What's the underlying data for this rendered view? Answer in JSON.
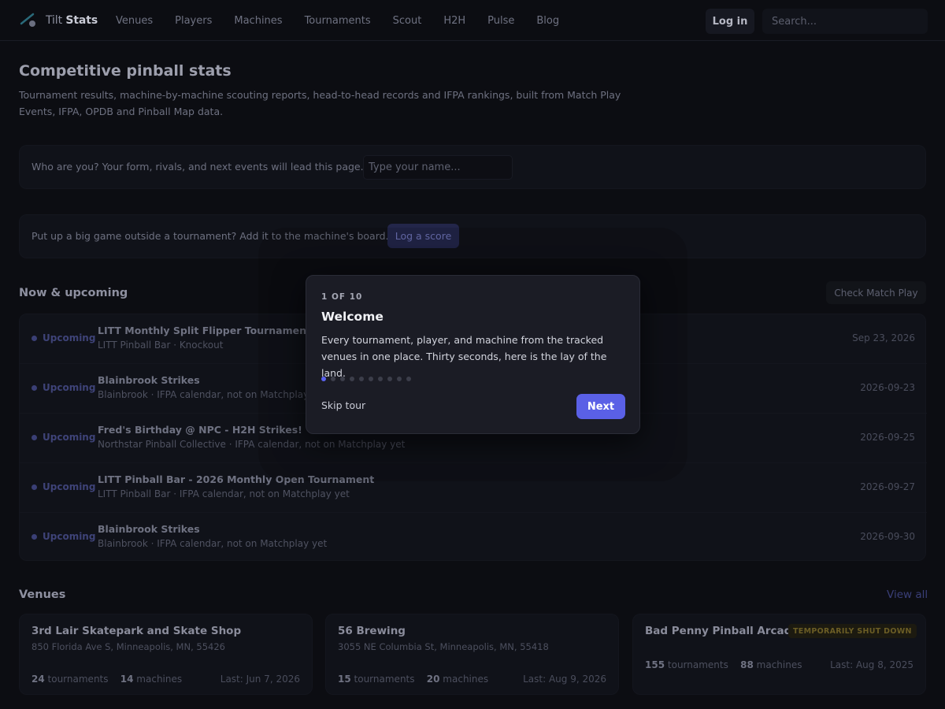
{
  "brand": {
    "prefix": "Tilt",
    "name": "Stats"
  },
  "nav": {
    "items": [
      "Venues",
      "Players",
      "Machines",
      "Tournaments",
      "Scout",
      "H2H",
      "Pulse",
      "Blog"
    ],
    "login_label": "Log in",
    "search_placeholder": "Search..."
  },
  "hero": {
    "title": "Competitive pinball stats",
    "subtitle": "Tournament results, machine-by-machine scouting reports, head-to-head records and IFPA rankings, built from Match Play Events, IFPA, OPDB and Pinball Map data."
  },
  "identify": {
    "prompt": "Who are you? Your form, rivals, and next events will lead this page.",
    "placeholder": "Type your name..."
  },
  "score": {
    "prompt": "Put up a big game outside a tournament? Add it to the machine's board.",
    "button_label": "Log a score"
  },
  "upcoming": {
    "title": "Now & upcoming",
    "check_label": "Check Match Play",
    "events": [
      {
        "status": "Upcoming",
        "title": "LITT Monthly Split Flipper Tournament - Se",
        "meta": "LITT Pinball Bar · Knockout",
        "date": "Sep 23, 2026"
      },
      {
        "status": "Upcoming",
        "title": "Blainbrook Strikes",
        "meta": "Blainbrook · IFPA calendar, not on Matchplay",
        "date": "2026-09-23"
      },
      {
        "status": "Upcoming",
        "title": "Fred's Birthday @ NPC - H2H Strikes!",
        "meta": "Northstar Pinball Collective · IFPA calendar, not on Matchplay yet",
        "date": "2026-09-25"
      },
      {
        "status": "Upcoming",
        "title": "LITT Pinball Bar - 2026 Monthly Open Tournament",
        "meta": "LITT Pinball Bar · IFPA calendar, not on Matchplay yet",
        "date": "2026-09-27"
      },
      {
        "status": "Upcoming",
        "title": "Blainbrook Strikes",
        "meta": "Blainbrook · IFPA calendar, not on Matchplay yet",
        "date": "2026-09-30"
      }
    ]
  },
  "venues": {
    "title": "Venues",
    "view_all_label": "View all",
    "tournaments_word": "tournaments",
    "machines_word": "machines",
    "items": [
      {
        "name": "3rd Lair Skatepark and Skate Shop",
        "address": "850 Florida Ave S, Minneapolis, MN, 55426",
        "tournaments": "24",
        "machines": "14",
        "last": "Last: Jun 7, 2026",
        "badge": ""
      },
      {
        "name": "56 Brewing",
        "address": "3055 NE Columbia St, Minneapolis, MN, 55418",
        "tournaments": "15",
        "machines": "20",
        "last": "Last: Aug 9, 2026",
        "badge": ""
      },
      {
        "name": "Bad Penny Pinball Arcade",
        "address": "",
        "tournaments": "155",
        "machines": "88",
        "last": "Last: Aug 8, 2025",
        "badge": "TEMPORARILY SHUT DOWN"
      }
    ]
  },
  "tour": {
    "step": "1 OF 10",
    "title": "Welcome",
    "body": "Every tournament, player, and machine from the tracked venues in one place. Thirty seconds, here is the lay of the land.",
    "total_steps": 10,
    "current_step": 1,
    "skip_label": "Skip tour",
    "next_label": "Next"
  },
  "colors": {
    "accent": "#5a60e6",
    "background": "#0c0d12",
    "badge_warning": "#6b5d25"
  }
}
